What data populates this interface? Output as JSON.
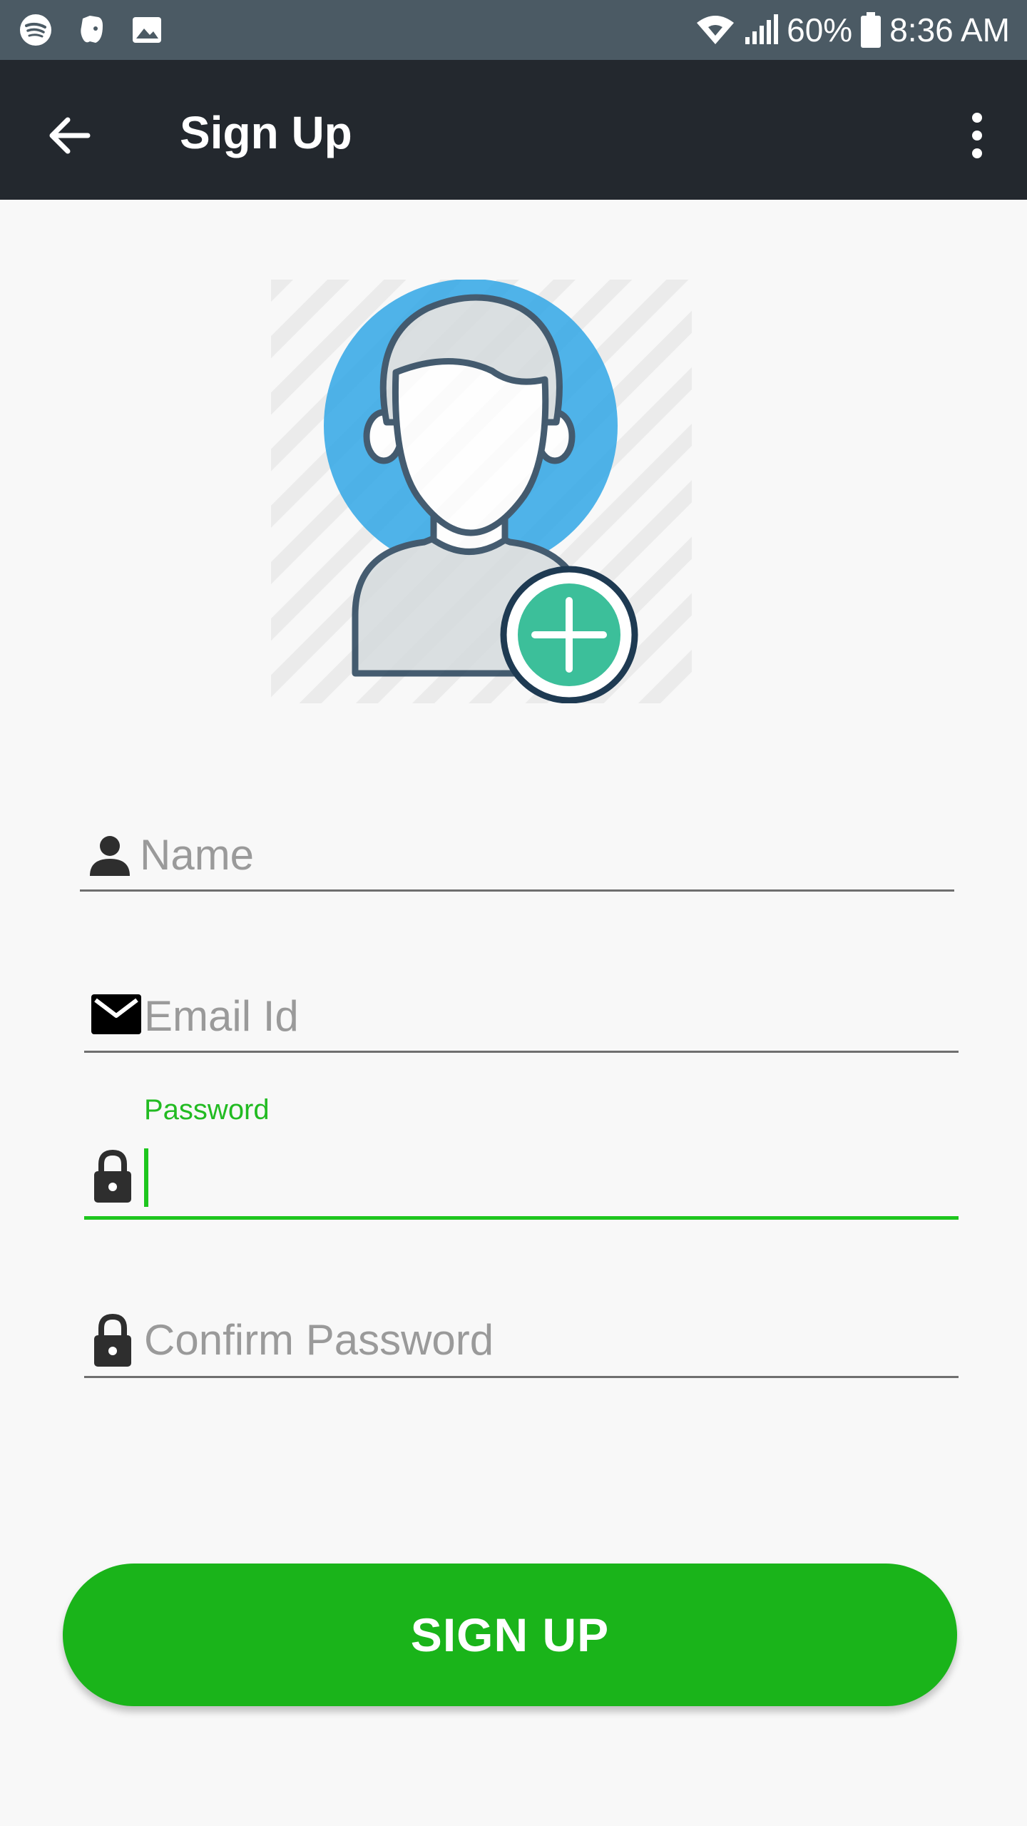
{
  "status_bar": {
    "icons": [
      "spotify-icon",
      "evernote-icon",
      "image-icon"
    ],
    "battery": "60%",
    "time": "8:36 AM"
  },
  "app_bar": {
    "title": "Sign Up",
    "back_icon": "arrow-back-icon",
    "menu_icon": "more-vert-icon"
  },
  "avatar": {
    "icon": "add-user-avatar-icon"
  },
  "form": {
    "name": {
      "placeholder": "Name",
      "icon": "person-icon"
    },
    "email": {
      "placeholder": "Email Id",
      "icon": "mail-icon"
    },
    "password": {
      "label": "Password",
      "icon": "lock-icon",
      "value": ""
    },
    "confirm_password": {
      "placeholder": "Confirm Password",
      "icon": "lock-icon"
    }
  },
  "submit": {
    "label": "SIGN UP"
  },
  "colors": {
    "accent_green": "#1ec61e",
    "button_green": "#1ab41a",
    "appbar": "#23282e",
    "statusbar": "#4b5a64",
    "avatar_blue": "#2aa4e6",
    "plus_teal": "#3cbf9a"
  }
}
